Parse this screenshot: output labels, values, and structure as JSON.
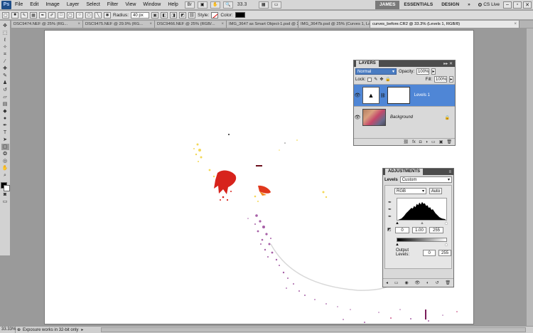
{
  "menubar": {
    "logo": "Ps",
    "items": [
      "File",
      "Edit",
      "Image",
      "Layer",
      "Select",
      "Filter",
      "View",
      "Window",
      "Help"
    ],
    "zoom": "33.3",
    "workspaces": [
      "JAMES",
      "ESSENTIALS",
      "DESIGN"
    ],
    "more": "»",
    "cs_live": "CS Live"
  },
  "options": {
    "radius_label": "Radius:",
    "radius_value": "40 px",
    "style_label": "Style:",
    "color_label": "Color:"
  },
  "tabs": [
    {
      "label": "DSC9474.NEF @ 25% (RG...",
      "active": false
    },
    {
      "label": "DSC9475.NEF @ 29.9% (RG...",
      "active": false
    },
    {
      "label": "DSC9466.NEF @ 25% (RGB/...",
      "active": false
    },
    {
      "label": "IMG_3647 as Smart Object-1.psd @ 2...",
      "active": false
    },
    {
      "label": "IMG_3647b.psd @ 25% (Curves 1, Lay...",
      "active": false
    },
    {
      "label": "curves_before.CR2 @ 33.3% (Levels 1, RGB/8)",
      "active": true
    }
  ],
  "layers_panel": {
    "title": "LAYERS",
    "blend_mode": "Normal",
    "opacity_label": "Opacity:",
    "opacity_value": "100%",
    "lock_label": "Lock:",
    "fill_label": "Fill:",
    "fill_value": "100%",
    "layers": [
      {
        "name": "Levels 1",
        "selected": true
      },
      {
        "name": "Background",
        "selected": false
      }
    ]
  },
  "adjustments_panel": {
    "title": "ADJUSTMENTS",
    "adjustment_name": "Levels",
    "preset": "Custom",
    "channel": "RGB",
    "auto_label": "Auto",
    "input_black": "0",
    "input_gamma": "1.00",
    "input_white": "255",
    "output_label": "Output Levels:",
    "output_black": "0",
    "output_white": "255"
  },
  "status": {
    "zoom": "33.33%",
    "message": "Exposure works in 32-bit only"
  },
  "colors": {
    "accent": "#4f86d6",
    "panel_title": "#4c4c4c"
  }
}
